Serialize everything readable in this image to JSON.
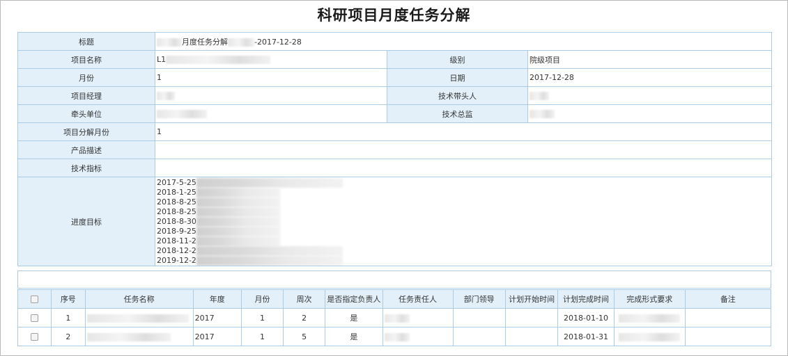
{
  "page": {
    "title": "科研项目月度任务分解"
  },
  "info": {
    "title_label": "标题",
    "title_value_mid": "月度任务分解",
    "title_value_end": "-2017-12-28",
    "project_name_label": "项目名称",
    "project_name_value": "L1",
    "level_label": "级别",
    "level_value": "院级项目",
    "month_label": "月份",
    "month_value": "1",
    "date_label": "日期",
    "date_value": "2017-12-28",
    "manager_label": "项目经理",
    "tech_lead_label": "技术带头人",
    "lead_unit_label": "牵头单位",
    "tech_director_label": "技术总监",
    "decomp_month_label": "项目分解月份",
    "decomp_month_value": "1",
    "product_desc_label": "产品描述",
    "tech_index_label": "技术指标",
    "progress_label": "进度目标",
    "progress_lines": [
      "2017-5-25",
      "2018-1-25",
      "2018-8-25",
      "2018-8-25",
      "2018-8-30",
      "2018-9-25",
      "2018-11-2",
      "2018-12-2",
      "2019-12-2"
    ]
  },
  "tasks": {
    "headers": {
      "index": "序号",
      "name": "任务名称",
      "year": "年度",
      "month": "月份",
      "week": "周次",
      "assigned": "是否指定负责人",
      "owner": "任务责任人",
      "dept_leader": "部门领导",
      "plan_start": "计划开始时间",
      "plan_end": "计划完成时间",
      "format": "完成形式要求",
      "remark": "备注"
    },
    "rows": [
      {
        "index": "1",
        "year": "2017",
        "month": "1",
        "week": "2",
        "assigned": "是",
        "plan_end": "2018-01-10"
      },
      {
        "index": "2",
        "year": "2017",
        "month": "1",
        "week": "5",
        "assigned": "是",
        "plan_end": "2018-01-31"
      }
    ]
  }
}
